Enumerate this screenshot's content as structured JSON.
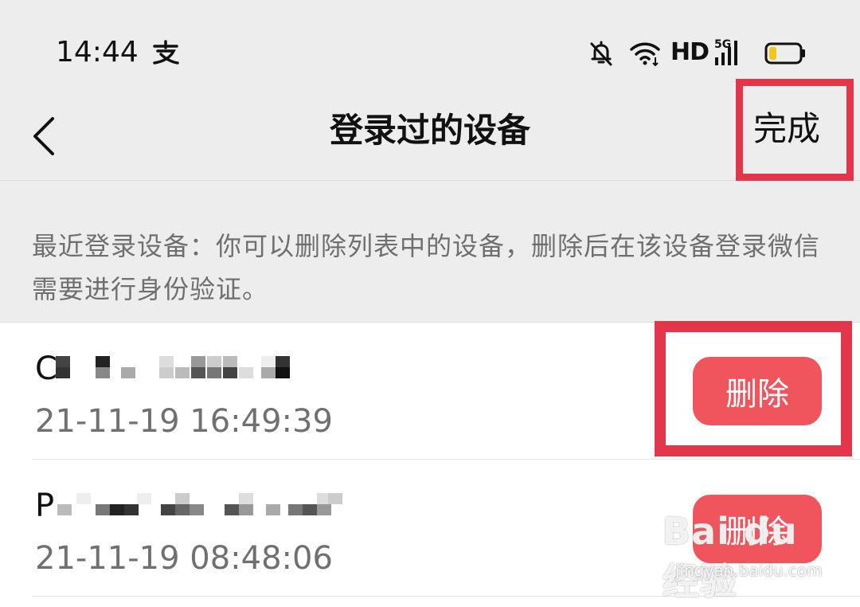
{
  "status_bar": {
    "time": "14:44",
    "network_hd": "HD",
    "network_type": "5G"
  },
  "nav": {
    "title": "登录过的设备",
    "done_label": "完成"
  },
  "description": "最近登录设备：你可以删除列表中的设备，删除后在该设备登录微信需要进行身份验证。",
  "devices": [
    {
      "name_prefix": "C",
      "time": "21-11-19 16:49:39",
      "delete_label": "删除"
    },
    {
      "name_prefix": "P",
      "time": "21-11-19 08:48:06",
      "delete_label": "删除"
    }
  ],
  "watermark": {
    "brand": "Bai du 经验",
    "url": "jingyan.baidu.com"
  },
  "colors": {
    "background": "#ededed",
    "delete_button": "#f0545c",
    "highlight": "#e4364a",
    "battery_level": "#f5c518"
  }
}
